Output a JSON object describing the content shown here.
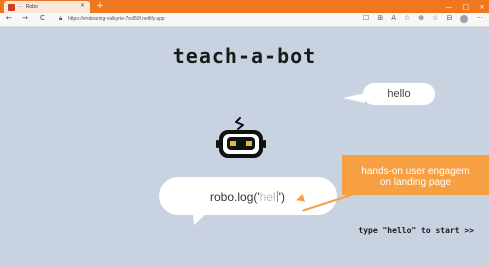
{
  "browser": {
    "tab_menu": "···",
    "tab_title": "Robo",
    "tab_close": "×",
    "new_tab": "+",
    "window_controls": [
      "—",
      "□",
      "×"
    ],
    "nav": {
      "back": "←",
      "forward": "→",
      "reload": "C"
    },
    "url": "https://endearing-valkyrie-7ed50f.netlify.app",
    "toolbar_icons": [
      "☐",
      "⊞",
      "A",
      "☆",
      "⊕",
      "☆",
      "⊟"
    ],
    "more": "···"
  },
  "page": {
    "title": "teach-a-bot",
    "bot_reply": "hello",
    "code_prefix": "robo.log('",
    "code_typed": "hel",
    "code_suffix": "')",
    "hint": "type \"hello\" to start >>"
  },
  "callout": {
    "line1": "hands-on user engagem",
    "line2": "on landing page"
  },
  "colors": {
    "tab_bar": "#ef7720",
    "page_background": "#c9d2e0",
    "callout": "#f6a043"
  }
}
